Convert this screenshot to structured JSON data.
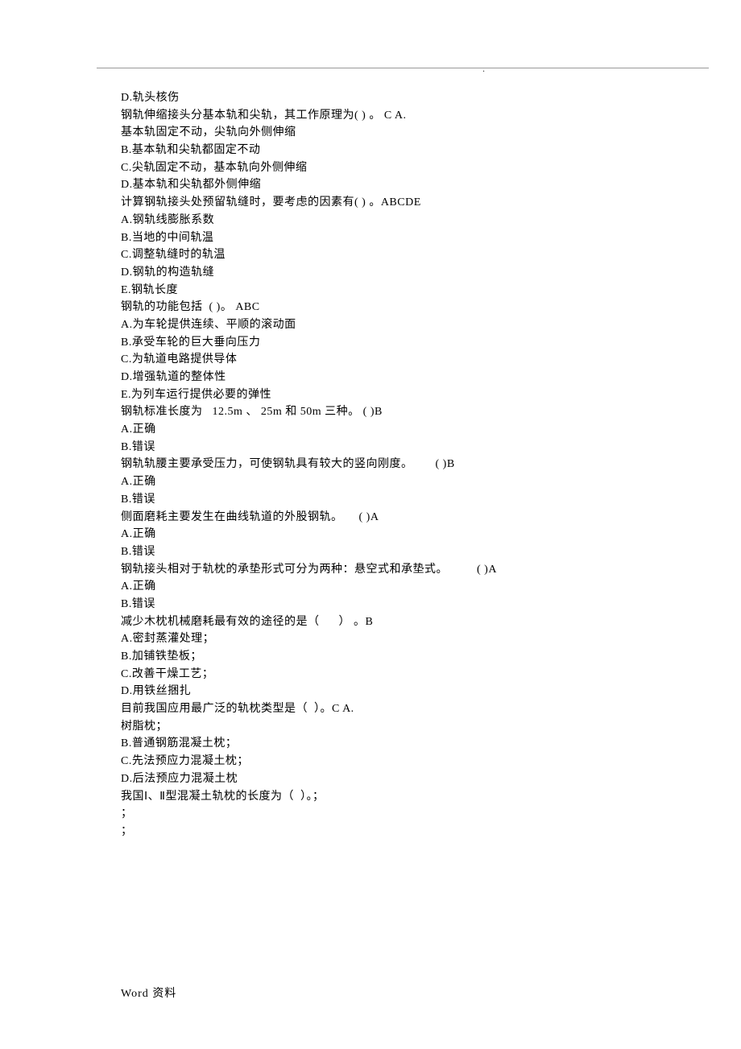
{
  "topDot": ".",
  "lines": [
    "D.轨头核伤",
    "钢轨伸缩接头分基本轨和尖轨，其工作原理为( ) 。 C A.",
    "基本轨固定不动，尖轨向外侧伸缩",
    "B.基本轨和尖轨都固定不动",
    "C.尖轨固定不动，基本轨向外侧伸缩",
    "D.基本轨和尖轨都外侧伸缩",
    "计算钢轨接头处预留轨缝时，要考虑的因素有( ) 。ABCDE",
    "A.钢轨线膨胀系数",
    "B.当地的中间轨温",
    "C.调整轨缝时的轨温",
    "D.钢轨的构造轨缝",
    "E.钢轨长度",
    "钢轨的功能包括  ( )。 ABC",
    "A.为车轮提供连续、平顺的滚动面",
    "B.承受车轮的巨大垂向压力",
    "C.为轨道电路提供导体",
    "D.增强轨道的整体性",
    "E.为列车运行提供必要的弹性",
    "钢轨标准长度为   12.5m 、 25m 和 50m 三种。 ( )B",
    "A.正确",
    "B.错误",
    "钢轨轨腰主要承受压力，可使钢轨具有较大的竖向刚度。       ( )B",
    "A.正确",
    "B.错误",
    "侧面磨耗主要发生在曲线轨道的外股钢轨。     ( )A",
    "A.正确",
    "B.错误",
    "钢轨接头相对于轨枕的承垫形式可分为两种：悬空式和承垫式。         ( )A",
    "A.正确",
    "B.错误",
    "减少木枕机械磨耗最有效的途径的是（      ） 。B",
    "A.密封蒸灌处理；",
    "B.加铺铁垫板；",
    "C.改善干燥工艺；",
    "D.用铁丝捆扎",
    "目前我国应用最广泛的轨枕类型是（  ）。C A.",
    "树脂枕；",
    "B.普通钢筋混凝土枕；",
    "C.先法预应力混凝土枕；",
    "D.后法预应力混凝土枕",
    "我国Ⅰ、Ⅱ型混凝土轨枕的长度为（  ）。；",
    "；",
    "；"
  ],
  "footer": "Word 资料"
}
